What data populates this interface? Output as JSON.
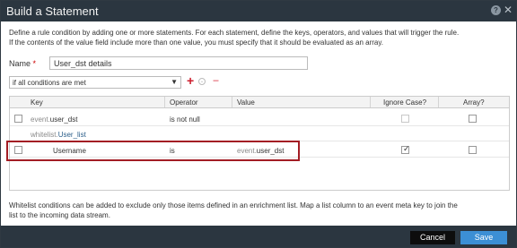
{
  "dialog": {
    "title": "Build a Statement",
    "help_icon": "?",
    "close_icon": "✕"
  },
  "description": {
    "line1": "Define a rule condition by adding one or more statements. For each statement, define the keys, operators, and values that will trigger the rule.",
    "line2": "If the contents of the value field include more than one value, you must specify that it should be evaluated as an array."
  },
  "name_field": {
    "label": "Name",
    "required_marker": "*",
    "value": "User_dst details"
  },
  "condition": {
    "selected": "if all conditions are met",
    "add_icon": "add-icon",
    "add_group_icon": "add-circle-icon",
    "remove_icon": "remove-icon"
  },
  "table": {
    "columns": [
      "Key",
      "Operator",
      "Value",
      "Ignore Case?",
      "Array?"
    ],
    "rows": [
      {
        "key_prefix": "event.",
        "key_name": "user_dst",
        "operator": "is not null",
        "value_prefix": "",
        "value_name": "",
        "ignore_case": false,
        "array": false
      },
      {
        "key_prefix": "whitelist.",
        "key_name": "User_list",
        "operator": "",
        "value_prefix": "",
        "value_name": "",
        "ignore_case": null,
        "array": null
      },
      {
        "key_prefix": "",
        "key_name": "Username",
        "operator": "is",
        "value_prefix": "event.",
        "value_name": "user_dst",
        "ignore_case": true,
        "array": false
      }
    ]
  },
  "footnote": {
    "line1": "Whitelist conditions can be added to exclude only those items defined in an enrichment list. Map a list column to an event meta key to join the",
    "line2": "list to the incoming data stream."
  },
  "buttons": {
    "cancel": "Cancel",
    "save": "Save"
  },
  "colors": {
    "titlebar": "#2b3640",
    "accent_red": "#cc1d2c",
    "highlight_border": "#a31d24",
    "save_blue": "#3c8fd5"
  }
}
